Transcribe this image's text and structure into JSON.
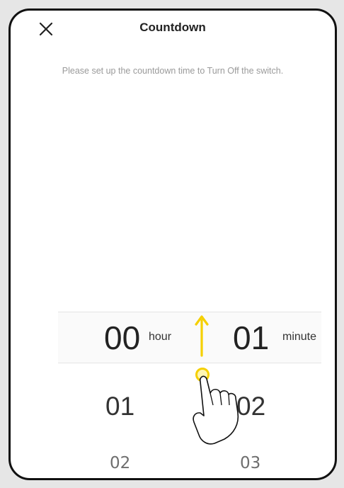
{
  "header": {
    "close_icon": "close-icon",
    "title": "Countdown"
  },
  "instruction": "Please set up the countdown time to Turn Off the switch.",
  "picker": {
    "hour": {
      "selected": "00",
      "unit": "hour",
      "below": [
        "01",
        "02"
      ]
    },
    "minute": {
      "selected": "01",
      "unit": "minute",
      "below": [
        "02",
        "03"
      ]
    }
  },
  "gesture": {
    "icon": "swipe-up-hand-icon",
    "direction": "up",
    "arrow_color": "#f5d000"
  }
}
